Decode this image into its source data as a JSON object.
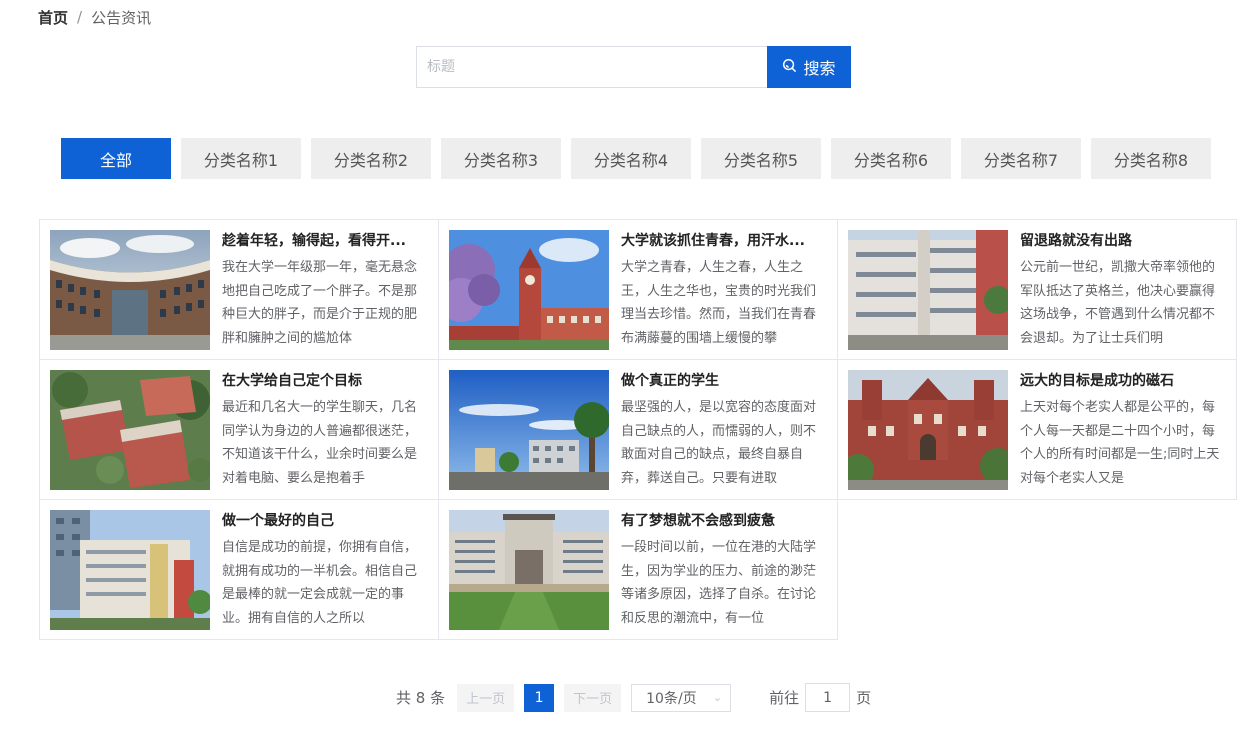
{
  "breadcrumb": {
    "home": "首页",
    "separator": "/",
    "current": "公告资讯"
  },
  "search": {
    "placeholder": "标题",
    "value": "",
    "button_label": "搜索"
  },
  "categories": [
    {
      "label": "全部",
      "active": true
    },
    {
      "label": "分类名称1"
    },
    {
      "label": "分类名称2"
    },
    {
      "label": "分类名称3"
    },
    {
      "label": "分类名称4"
    },
    {
      "label": "分类名称5"
    },
    {
      "label": "分类名称6"
    },
    {
      "label": "分类名称7"
    },
    {
      "label": "分类名称8"
    }
  ],
  "articles": [
    {
      "title": "趁着年轻，输得起，看得开...",
      "desc": "我在大学一年级那一年，毫无悬念地把自己吃成了一个胖子。不是那种巨大的胖子，而是介于正规的肥胖和臃肿之间的尴尬体"
    },
    {
      "title": "大学就该抓住青春，用汗水...",
      "desc": "大学之青春，人生之春，人生之王，人生之华也，宝贵的时光我们理当去珍惜。然而，当我们在青春布满藤蔓的围墙上缓慢的攀"
    },
    {
      "title": "留退路就没有出路",
      "desc": "公元前一世纪，凯撒大帝率领他的军队抵达了英格兰，他决心要赢得这场战争，不管遇到什么情况都不会退却。为了让士兵们明"
    },
    {
      "title": "在大学给自己定个目标",
      "desc": "最近和几名大一的学生聊天，几名同学认为身边的人普遍都很迷茫，不知道该干什么，业余时间要么是对着电脑、要么是抱着手"
    },
    {
      "title": "做个真正的学生",
      "desc": "最坚强的人，是以宽容的态度面对自己缺点的人，而懦弱的人，则不敢面对自己的缺点，最终自暴自弃，葬送自己。只要有进取"
    },
    {
      "title": "远大的目标是成功的磁石",
      "desc": "上天对每个老实人都是公平的，每个人每一天都是二十四个小时，每个人的所有时间都是一生;同时上天对每个老实人又是"
    },
    {
      "title": "做一个最好的自己",
      "desc": "自信是成功的前提，你拥有自信，就拥有成功的一半机会。相信自己是最棒的就一定会成就一定的事业。拥有自信的人之所以"
    },
    {
      "title": "有了梦想就不会感到疲惫",
      "desc": "一段时间以前，一位在港的大陆学生，因为学业的压力、前途的渺茫等诸多原因，选择了自杀。在讨论和反思的潮流中，有一位"
    }
  ],
  "pagination": {
    "total_text": "共 8 条",
    "prev_label": "上一页",
    "current_page": "1",
    "next_label": "下一页",
    "page_size": "10条/页",
    "goto_label": "前往",
    "goto_value": "1",
    "goto_suffix": "页"
  },
  "icons": {
    "search": "search-icon",
    "chevron": "chevron-down-icon"
  },
  "colors": {
    "accent": "#0f62d6",
    "inactive_tab": "#eeeeee",
    "border": "#e4e7ed"
  }
}
